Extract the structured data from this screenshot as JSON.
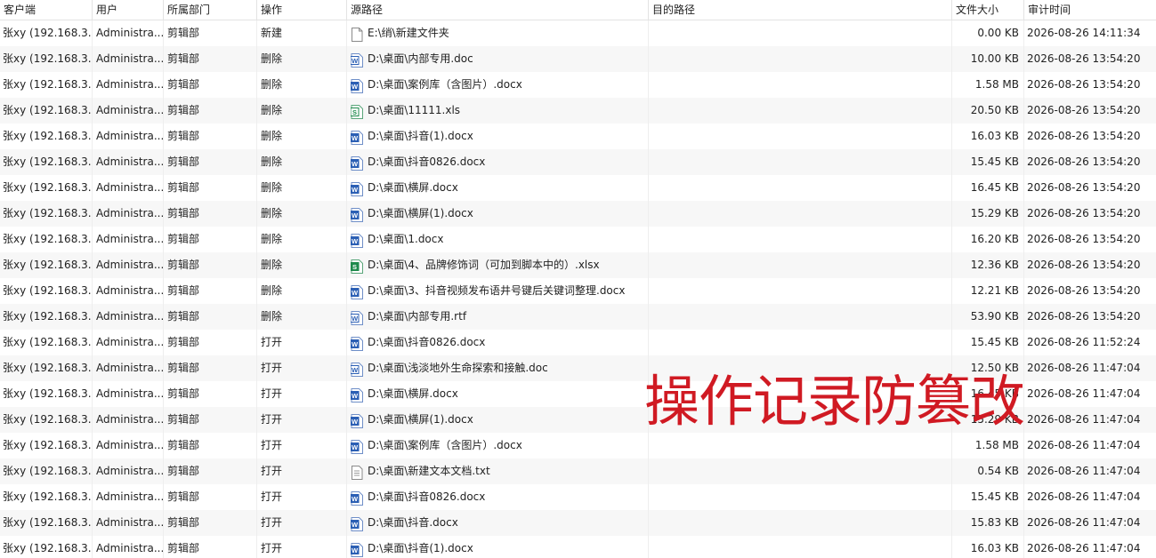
{
  "columns": {
    "client": "客户端",
    "user": "用户",
    "dept": "所属部门",
    "op": "操作",
    "src": "源路径",
    "dst": "目的路径",
    "size": "文件大小",
    "time": "审计时间"
  },
  "rows": [
    {
      "client": "张xy (192.168.3...",
      "user": "Administra...",
      "dept": "剪辑部",
      "op": "新建",
      "icon": "folder",
      "src": "E:\\绡\\新建文件夹",
      "dst": "",
      "size": "0.00 KB",
      "time": "2026-08-26 14:11:34"
    },
    {
      "client": "张xy (192.168.3...",
      "user": "Administra...",
      "dept": "剪辑部",
      "op": "删除",
      "icon": "word-doc",
      "src": "D:\\桌面\\内部专用.doc",
      "dst": "",
      "size": "10.00 KB",
      "time": "2026-08-26 13:54:20"
    },
    {
      "client": "张xy (192.168.3...",
      "user": "Administra...",
      "dept": "剪辑部",
      "op": "删除",
      "icon": "word",
      "src": "D:\\桌面\\案例库（含图片）.docx",
      "dst": "",
      "size": "1.58 MB",
      "time": "2026-08-26 13:54:20"
    },
    {
      "client": "张xy (192.168.3...",
      "user": "Administra...",
      "dept": "剪辑部",
      "op": "删除",
      "icon": "excel-xls",
      "src": "D:\\桌面\\11111.xls",
      "dst": "",
      "size": "20.50 KB",
      "time": "2026-08-26 13:54:20"
    },
    {
      "client": "张xy (192.168.3...",
      "user": "Administra...",
      "dept": "剪辑部",
      "op": "删除",
      "icon": "word",
      "src": "D:\\桌面\\抖音(1).docx",
      "dst": "",
      "size": "16.03 KB",
      "time": "2026-08-26 13:54:20"
    },
    {
      "client": "张xy (192.168.3...",
      "user": "Administra...",
      "dept": "剪辑部",
      "op": "删除",
      "icon": "word",
      "src": "D:\\桌面\\抖音0826.docx",
      "dst": "",
      "size": "15.45 KB",
      "time": "2026-08-26 13:54:20"
    },
    {
      "client": "张xy (192.168.3...",
      "user": "Administra...",
      "dept": "剪辑部",
      "op": "删除",
      "icon": "word",
      "src": "D:\\桌面\\横屏.docx",
      "dst": "",
      "size": "16.45 KB",
      "time": "2026-08-26 13:54:20"
    },
    {
      "client": "张xy (192.168.3...",
      "user": "Administra...",
      "dept": "剪辑部",
      "op": "删除",
      "icon": "word",
      "src": "D:\\桌面\\横屏(1).docx",
      "dst": "",
      "size": "15.29 KB",
      "time": "2026-08-26 13:54:20"
    },
    {
      "client": "张xy (192.168.3...",
      "user": "Administra...",
      "dept": "剪辑部",
      "op": "删除",
      "icon": "word",
      "src": "D:\\桌面\\1.docx",
      "dst": "",
      "size": "16.20 KB",
      "time": "2026-08-26 13:54:20"
    },
    {
      "client": "张xy (192.168.3...",
      "user": "Administra...",
      "dept": "剪辑部",
      "op": "删除",
      "icon": "excel",
      "src": "D:\\桌面\\4、品牌修饰词（可加到脚本中的）.xlsx",
      "dst": "",
      "size": "12.36 KB",
      "time": "2026-08-26 13:54:20"
    },
    {
      "client": "张xy (192.168.3...",
      "user": "Administra...",
      "dept": "剪辑部",
      "op": "删除",
      "icon": "word",
      "src": "D:\\桌面\\3、抖音视频发布语井号键后关键词整理.docx",
      "dst": "",
      "size": "12.21 KB",
      "time": "2026-08-26 13:54:20"
    },
    {
      "client": "张xy (192.168.3...",
      "user": "Administra...",
      "dept": "剪辑部",
      "op": "删除",
      "icon": "word-doc",
      "src": "D:\\桌面\\内部专用.rtf",
      "dst": "",
      "size": "53.90 KB",
      "time": "2026-08-26 13:54:20"
    },
    {
      "client": "张xy (192.168.3...",
      "user": "Administra...",
      "dept": "剪辑部",
      "op": "打开",
      "icon": "word",
      "src": "D:\\桌面\\抖音0826.docx",
      "dst": "",
      "size": "15.45 KB",
      "time": "2026-08-26 11:52:24"
    },
    {
      "client": "张xy (192.168.3...",
      "user": "Administra...",
      "dept": "剪辑部",
      "op": "打开",
      "icon": "word-doc",
      "src": "D:\\桌面\\浅淡地外生命探索和接触.doc",
      "dst": "",
      "size": "12.50 KB",
      "time": "2026-08-26 11:47:04"
    },
    {
      "client": "张xy (192.168.3...",
      "user": "Administra...",
      "dept": "剪辑部",
      "op": "打开",
      "icon": "word",
      "src": "D:\\桌面\\横屏.docx",
      "dst": "",
      "size": "16.45 KB",
      "time": "2026-08-26 11:47:04"
    },
    {
      "client": "张xy (192.168.3...",
      "user": "Administra...",
      "dept": "剪辑部",
      "op": "打开",
      "icon": "word",
      "src": "D:\\桌面\\横屏(1).docx",
      "dst": "",
      "size": "15.29 KB",
      "time": "2026-08-26 11:47:04"
    },
    {
      "client": "张xy (192.168.3...",
      "user": "Administra...",
      "dept": "剪辑部",
      "op": "打开",
      "icon": "word",
      "src": "D:\\桌面\\案例库（含图片）.docx",
      "dst": "",
      "size": "1.58 MB",
      "time": "2026-08-26 11:47:04"
    },
    {
      "client": "张xy (192.168.3...",
      "user": "Administra...",
      "dept": "剪辑部",
      "op": "打开",
      "icon": "text",
      "src": "D:\\桌面\\新建文本文档.txt",
      "dst": "",
      "size": "0.54 KB",
      "time": "2026-08-26 11:47:04"
    },
    {
      "client": "张xy (192.168.3...",
      "user": "Administra...",
      "dept": "剪辑部",
      "op": "打开",
      "icon": "word",
      "src": "D:\\桌面\\抖音0826.docx",
      "dst": "",
      "size": "15.45 KB",
      "time": "2026-08-26 11:47:04"
    },
    {
      "client": "张xy (192.168.3...",
      "user": "Administra...",
      "dept": "剪辑部",
      "op": "打开",
      "icon": "word",
      "src": "D:\\桌面\\抖音.docx",
      "dst": "",
      "size": "15.83 KB",
      "time": "2026-08-26 11:47:04"
    },
    {
      "client": "张xy (192.168.3...",
      "user": "Administra...",
      "dept": "剪辑部",
      "op": "打开",
      "icon": "word",
      "src": "D:\\桌面\\抖音(1).docx",
      "dst": "",
      "size": "16.03 KB",
      "time": "2026-08-26 11:47:04"
    }
  ],
  "overlay_text": "操作记录防篡改",
  "colors": {
    "overlay": "#d01a23",
    "word": "#2b5fb4",
    "excel": "#1e8a4c",
    "row_alt": "#f7f7f7",
    "grid_line": "#e3e3e3"
  }
}
